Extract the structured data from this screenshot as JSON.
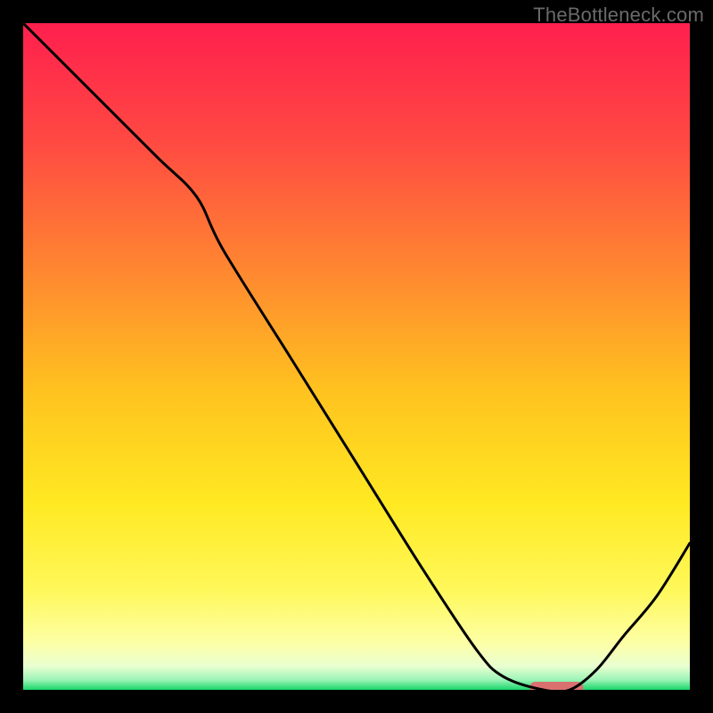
{
  "watermark": "TheBottleneck.com",
  "chart_data": {
    "type": "line",
    "title": "",
    "xlabel": "",
    "ylabel": "",
    "xlim": [
      0,
      100
    ],
    "ylim": [
      0,
      100
    ],
    "grid": false,
    "legend": false,
    "series": [
      {
        "name": "curve",
        "x": [
          0,
          10,
          20,
          26,
          30,
          40,
          50,
          60,
          68,
          72,
          78,
          82,
          86,
          90,
          95,
          100
        ],
        "values": [
          100,
          90,
          80,
          74,
          66,
          50,
          34,
          18,
          6,
          2,
          0,
          0,
          3,
          8,
          14,
          22
        ]
      }
    ],
    "marker": {
      "x_start": 76,
      "x_end": 84,
      "y": 0,
      "color": "#d9706f"
    },
    "gradient_stops": [
      {
        "offset": 0.0,
        "color": "#ff1f4e"
      },
      {
        "offset": 0.18,
        "color": "#ff4a42"
      },
      {
        "offset": 0.38,
        "color": "#ff8a30"
      },
      {
        "offset": 0.55,
        "color": "#ffc21f"
      },
      {
        "offset": 0.72,
        "color": "#ffe922"
      },
      {
        "offset": 0.85,
        "color": "#fff85a"
      },
      {
        "offset": 0.93,
        "color": "#fdffa6"
      },
      {
        "offset": 0.965,
        "color": "#e9ffd1"
      },
      {
        "offset": 0.985,
        "color": "#9cf4b7"
      },
      {
        "offset": 1.0,
        "color": "#18d66a"
      }
    ]
  }
}
